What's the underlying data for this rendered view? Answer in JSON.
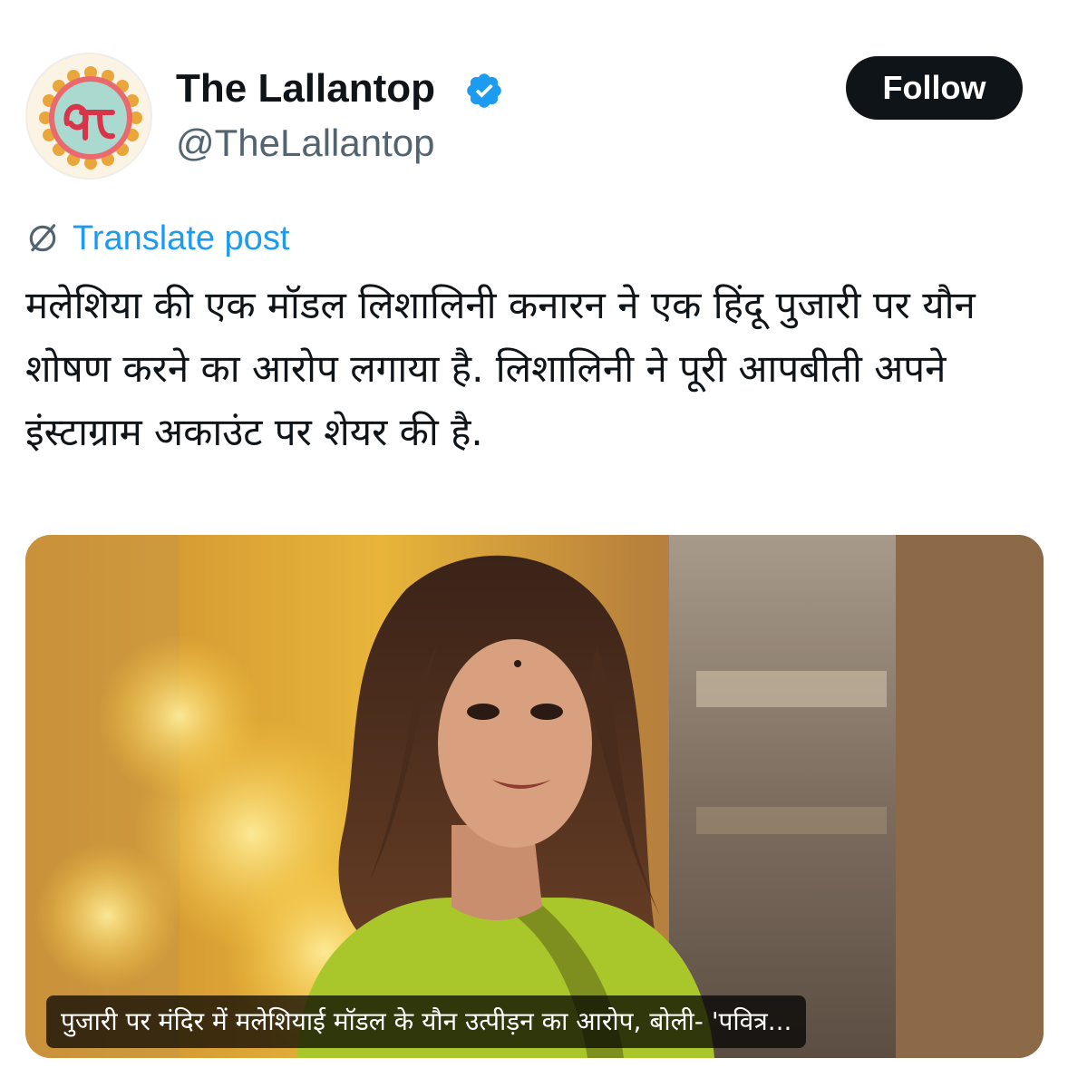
{
  "author": {
    "display_name": "The Lallantop",
    "handle": "@TheLallantop",
    "avatar_icon": "lallantop-logo-icon",
    "verified_icon": "verified-badge-icon",
    "verified_color": "#1d9bf0"
  },
  "actions": {
    "follow_label": "Follow"
  },
  "translate": {
    "icon": "globe-slash-icon",
    "label": "Translate post",
    "color": "#1d9bf0"
  },
  "post": {
    "text": "मलेशिया की एक मॉडल लिशालिनी कनारन ने एक हिंदू पुजारी पर यौन शोषण करने का आरोप लगाया है. लिशालिनी ने पूरी आपबीती अपने इंस्टाग्राम अकाउंट पर शेयर की है."
  },
  "media": {
    "caption": "पुजारी पर मंदिर में मलेशियाई मॉडल के यौन उत्पीड़न का आरोप, बोली- 'पवित्र..."
  },
  "colors": {
    "text_primary": "#0f1419",
    "text_secondary": "#536471",
    "button_bg": "#0f1419",
    "accent": "#1d9bf0"
  }
}
